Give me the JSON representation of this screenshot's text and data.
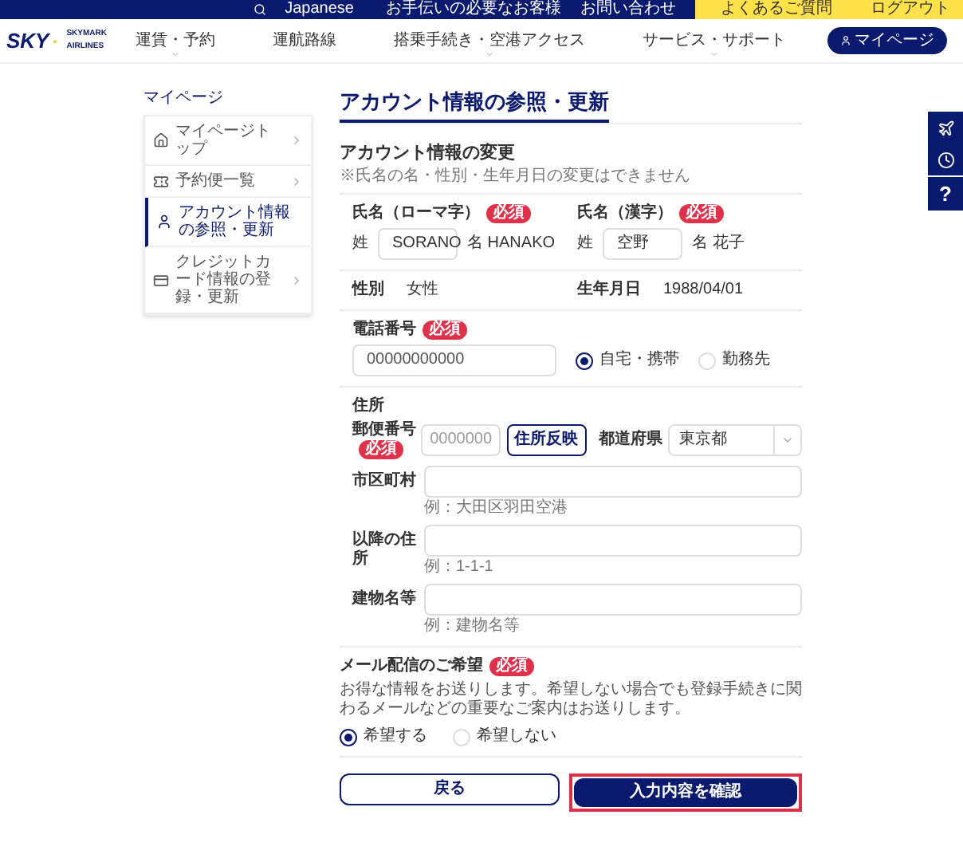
{
  "top_bar": {
    "language": "Japanese",
    "links": [
      "お手伝いの必要なお客様",
      "お問い合わせ"
    ],
    "faq": "よくあるご質問",
    "logout": "ログアウト"
  },
  "header": {
    "logo": "SKY",
    "brand": "SKYMARK AIRLINES",
    "nav": [
      {
        "label": "運賃・予約",
        "dropdown": true
      },
      {
        "label": "運航路線",
        "dropdown": false
      },
      {
        "label": "搭乗手続き・空港アクセス",
        "dropdown": true
      },
      {
        "label": "サービス・サポート",
        "dropdown": true
      }
    ],
    "mypage": "マイページ"
  },
  "breadcrumb": "マイページ",
  "sidebar": {
    "items": [
      {
        "label": "マイページトップ",
        "kind": "home",
        "selected": false
      },
      {
        "label": "予約便一覧",
        "kind": "ticket",
        "selected": false
      },
      {
        "label": "アカウント情報の参照・更新",
        "kind": "user",
        "selected": true
      },
      {
        "label": "クレジットカード情報の登録・更新",
        "kind": "card",
        "selected": false
      }
    ]
  },
  "page_title": "アカウント情報の参照・更新",
  "section_title": "アカウント情報の変更",
  "note": "※氏名の名・性別・生年月日の変更はできません",
  "names": [
    {
      "label": "氏名（ローマ字）",
      "badge": "必須",
      "last_label": "姓",
      "last_value": "SORANO",
      "first_label": "名",
      "first_value": "HANAKO"
    },
    {
      "label": "氏名（漢字）",
      "badge": "必須",
      "last_label": "姓",
      "last_value": "空野",
      "first_label": "名",
      "first_value": "花子"
    }
  ],
  "info": [
    {
      "label": "性別",
      "value": "女性"
    },
    {
      "label": "生年月日",
      "value": "1988/04/01"
    }
  ],
  "phone": {
    "label": "電話番号",
    "badge": "必須",
    "value": "00000000000",
    "options": [
      {
        "label": "自宅・携帯",
        "selected": true
      },
      {
        "label": "勤務先",
        "selected": false
      }
    ]
  },
  "address": {
    "label": "住所",
    "postal_label": "郵便番号",
    "postal_badge": "必須",
    "postal_placeholder": "0000000",
    "lookup_button": "住所反映",
    "prefecture_label": "都道府県",
    "prefecture_value": "東京都",
    "fields": [
      {
        "label": "市区町村",
        "hint": "例：大田区羽田空港"
      },
      {
        "label": "以降の住所",
        "hint": "例：1-1-1"
      },
      {
        "label": "建物名等",
        "hint": "例：建物名等"
      }
    ]
  },
  "mail": {
    "label": "メール配信のご希望",
    "badge": "必須",
    "description": "お得な情報をお送りします。希望しない場合でも登録手続きに関わるメールなどの重要なご案内はお送りします。",
    "options": [
      {
        "label": "希望する",
        "selected": true
      },
      {
        "label": "希望しない",
        "selected": false
      }
    ]
  },
  "buttons": {
    "back": "戻る",
    "confirm": "入力内容を確認"
  },
  "side_tools": [
    {
      "kind": "plane"
    },
    {
      "kind": "clock"
    },
    {
      "kind": "text",
      "label": "?"
    }
  ]
}
